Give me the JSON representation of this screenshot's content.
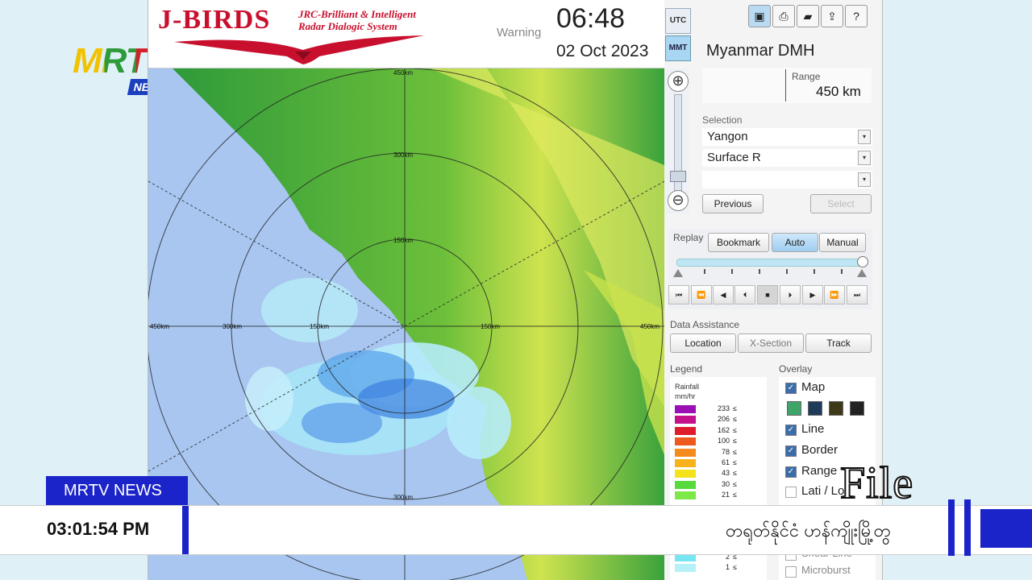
{
  "broadcast": {
    "logo_text": "MRTV",
    "logo_badge": "NEWS",
    "news_tag": "MRTV NEWS",
    "lower_time": "03:01:54  PM",
    "ticker_text": "တရုတ်နိုင်ငံ ဟန်ကျိုးမြို့တွ",
    "watermark": "File",
    "brand_color": "#1b24c9"
  },
  "header": {
    "brand_title": "J-BIRDS",
    "brand_sub_line1": "JRC-Brilliant & Intelligent",
    "brand_sub_line2": "Radar Dialogic System",
    "warning_label": "Warning",
    "time": "06:48",
    "date": "02 Oct 2023",
    "tz_utc": "UTC",
    "tz_mmt": "MMT"
  },
  "toolbar": {
    "icons": [
      "save-icon",
      "print-icon",
      "folder-icon",
      "export-icon",
      "help-icon"
    ]
  },
  "map": {
    "range_labels": [
      "150km",
      "300km",
      "450km",
      "150km",
      "300km",
      "450km",
      "150km",
      "300km",
      "450km"
    ],
    "colors": {
      "sea": "#a8c6f0",
      "land_low": "#2f9a3a",
      "land_high": "#d9e85a",
      "rain_light": "#9fe2f6",
      "rain_mid": "#3a7fe0"
    }
  },
  "panel": {
    "station": "Myanmar DMH",
    "range_label": "Range",
    "range_value": "450 km",
    "selection_label": "Selection",
    "selection_values": [
      "Yangon",
      "Surface R",
      ""
    ],
    "previous_label": "Previous",
    "select_label": "Select",
    "replay_label": "Replay",
    "bookmark_label": "Bookmark",
    "auto_label": "Auto",
    "manual_label": "Manual",
    "replay_position": 1.0,
    "data_assistance_label": "Data Assistance",
    "location_label": "Location",
    "xsection_label": "X-Section",
    "track_label": "Track",
    "legend_label": "Legend",
    "overlay_label": "Overlay"
  },
  "legend": {
    "title": "Rainfall",
    "unit": "mm/hr",
    "rows": [
      {
        "value": "233",
        "color": "#9b10b5"
      },
      {
        "value": "206",
        "color": "#c4108a"
      },
      {
        "value": "162",
        "color": "#e01c2c"
      },
      {
        "value": "100",
        "color": "#ee5a1e"
      },
      {
        "value": "78",
        "color": "#f58a1e"
      },
      {
        "value": "61",
        "color": "#f7b21c"
      },
      {
        "value": "43",
        "color": "#f4e21a"
      },
      {
        "value": "30",
        "color": "#58d93c"
      },
      {
        "value": "21",
        "color": "#7ce84a"
      },
      {
        "value": "2",
        "color": "#76e6f2"
      },
      {
        "value": "1",
        "color": "#b6f1f7"
      }
    ],
    "le_symbol": "≤"
  },
  "overlay": {
    "items": [
      {
        "label": "Map",
        "checked": true
      },
      {
        "label": "Line",
        "checked": true
      },
      {
        "label": "Border",
        "checked": true
      },
      {
        "label": "Range",
        "checked": true
      },
      {
        "label": "Lati / Lo",
        "checked": false
      },
      {
        "label": "Shear Line",
        "checked": false
      },
      {
        "label": "Microburst",
        "checked": false
      }
    ],
    "map_swatches": [
      "#3fa46a",
      "#1f3b5a",
      "#3e3a18",
      "#222222"
    ]
  }
}
